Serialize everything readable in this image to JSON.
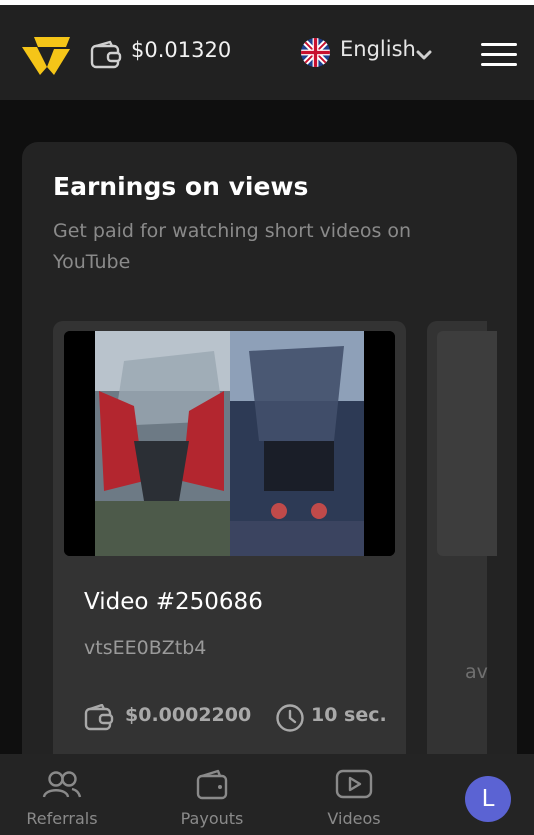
{
  "header": {
    "balance": "$0.01320",
    "language": "English"
  },
  "earnings": {
    "title": "Earnings on views",
    "subtitle": "Get paid for watching short videos on YouTube"
  },
  "videos": [
    {
      "title": "Video #250686",
      "video_id": "vtsEE0BZtb4",
      "reward": "$0.0002200",
      "duration": "10 sec."
    },
    {
      "partial_text": "av"
    }
  ],
  "bottom_nav": {
    "items": [
      {
        "label": "Referrals",
        "icon": "referrals-icon"
      },
      {
        "label": "Payouts",
        "icon": "wallet-icon"
      },
      {
        "label": "Videos",
        "icon": "play-icon"
      }
    ],
    "avatar_initial": "L"
  },
  "colors": {
    "logo_yellow": "#f5c518",
    "header_bg": "#212121",
    "card_bg": "#232323",
    "video_card_bg": "#333333",
    "avatar_bg": "#5b63d3"
  }
}
